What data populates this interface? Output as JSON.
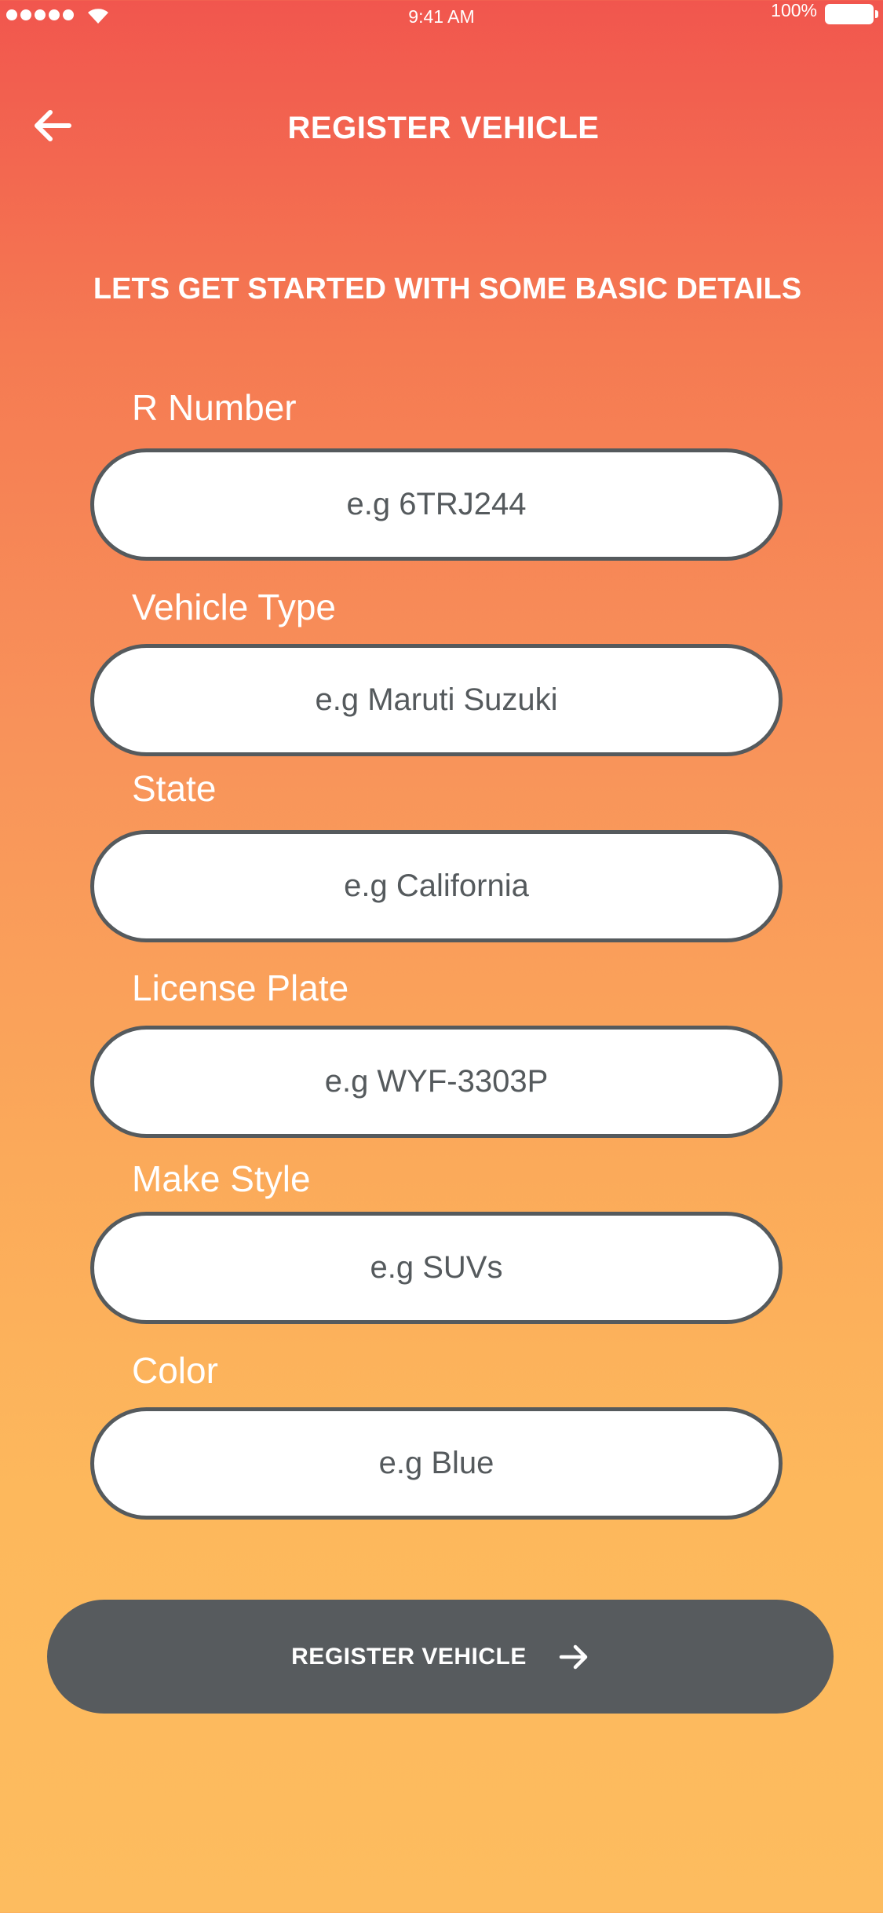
{
  "status_bar": {
    "time": "9:41 AM",
    "battery": "100%",
    "signal_icon": "signal-dots-icon",
    "wifi_icon": "wifi-icon",
    "battery_icon": "battery-icon"
  },
  "header": {
    "title": "REGISTER VEHICLE",
    "back_icon": "arrow-left-icon"
  },
  "subtitle": "LETS GET STARTED WITH SOME BASIC DETAILS",
  "form": {
    "fields": [
      {
        "label": "R Number",
        "placeholder": "e.g 6TRJ244",
        "value": ""
      },
      {
        "label": "Vehicle Type",
        "placeholder": "e.g Maruti Suzuki",
        "value": ""
      },
      {
        "label": "State",
        "placeholder": "e.g California",
        "value": ""
      },
      {
        "label": "License Plate",
        "placeholder": "e.g WYF-3303P",
        "value": ""
      },
      {
        "label": "Make Style",
        "placeholder": "e.g SUVs",
        "value": ""
      },
      {
        "label": "Color",
        "placeholder": "e.g Blue",
        "value": ""
      }
    ]
  },
  "submit": {
    "label": "REGISTER VEHICLE",
    "icon": "arrow-right-icon"
  },
  "colors": {
    "gradient_top": "#f1564e",
    "gradient_bottom": "#fdbc5f",
    "button_bg": "#575b5e",
    "input_border": "#555a5d",
    "text_light": "#ffffff"
  }
}
